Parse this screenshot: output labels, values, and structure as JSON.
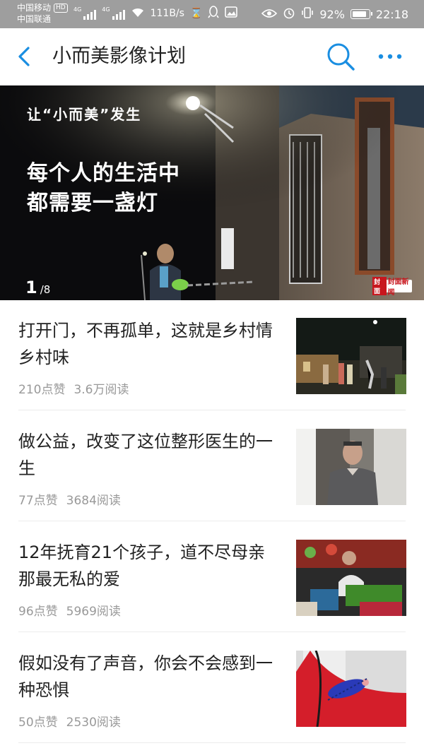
{
  "status_bar": {
    "carrier_1": "中国移动",
    "carrier_2": "中国联通",
    "hd": "HD",
    "network_label": "4G",
    "speed": "111B/s",
    "battery": "92%",
    "battery_level": 0.92,
    "time": "22:18"
  },
  "header": {
    "title": "小而美影像计划"
  },
  "banner": {
    "kicker": "让“小而美”发生",
    "headline_line1": "每个人的生活中",
    "headline_line2": "都需要一盏灯",
    "page_current": "1",
    "page_total": "/8",
    "logo_mark": "封面",
    "logo_text": "封面新闻"
  },
  "articles": [
    {
      "title": "打开门，不再孤单，这就是乡村情乡村味",
      "likes": "210点赞",
      "reads": "3.6万阅读"
    },
    {
      "title": "做公益，改变了这位整形医生的一生",
      "likes": "77点赞",
      "reads": "3684阅读"
    },
    {
      "title": "12年抚育21个孩子，道不尽母亲那最无私的爱",
      "likes": "96点赞",
      "reads": "5969阅读"
    },
    {
      "title": "假如没有了声音，你会不会感到一种恐惧",
      "likes": "50点赞",
      "reads": "2530阅读"
    }
  ],
  "colors": {
    "accent": "#1a8ee1",
    "status_bar": "#9e9e9e",
    "meta_text": "#999999"
  }
}
